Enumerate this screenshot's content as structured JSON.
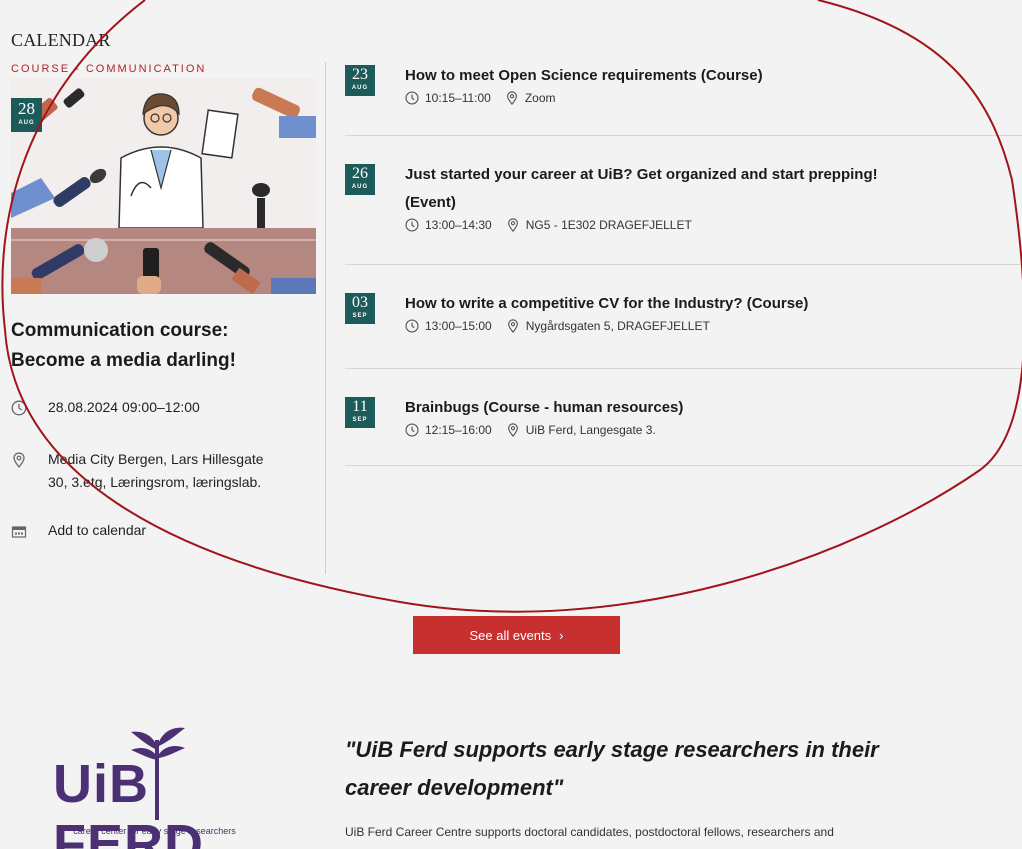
{
  "section": {
    "title": "CALENDAR"
  },
  "featured": {
    "category": "COURSE - COMMUNICATION",
    "badge": {
      "day": "28",
      "month": "AUG"
    },
    "title_line1": "Communication course:",
    "title_line2": "Become a media darling!",
    "datetime": "28.08.2024 09:00–12:00",
    "location_line1": "Media City Bergen, Lars Hillesgate",
    "location_line2": "30, 3.etg, Læringsrom, læringslab.",
    "add_to_calendar": "Add to calendar",
    "icons": [
      "clock-icon",
      "location-pin-icon",
      "calendar-icon"
    ]
  },
  "events": [
    {
      "day": "23",
      "month": "AUG",
      "title_line1": "How to meet Open Science requirements (Course)",
      "title_line2": "",
      "time": "10:15–11:00",
      "location": "Zoom"
    },
    {
      "day": "26",
      "month": "AUG",
      "title_line1": "Just started your career at UiB? Get organized and start prepping!",
      "title_line2": "(Event)",
      "time": "13:00–14:30",
      "location": "NG5 - 1E302 DRAGEFJELLET"
    },
    {
      "day": "03",
      "month": "SEP",
      "title_line1": "How to write a competitive CV for the Industry? (Course)",
      "title_line2": "",
      "time": "13:00–15:00",
      "location": "Nygårdsgaten 5, DRAGEFJELLET"
    },
    {
      "day": "11",
      "month": "SEP",
      "title_line1": "Brainbugs (Course - human resources)",
      "title_line2": "",
      "time": "12:15–16:00",
      "location": "UiB Ferd, Langesgate 3."
    }
  ],
  "see_all": {
    "label": "See all events",
    "chevron": "›"
  },
  "logo": {
    "text_left": "UiB",
    "text_right": "FERD",
    "tagline": "career center for early stage researchers"
  },
  "quote": "\"UiB Ferd supports early stage researchers in their career development\"",
  "intro": "UiB Ferd Career Centre supports doctoral candidates, postdoctoral fellows, researchers and",
  "colors": {
    "accent": "#c8302f",
    "badge": "#1d5b5b",
    "logo": "#4b3173",
    "annotation": "#a0151b"
  }
}
